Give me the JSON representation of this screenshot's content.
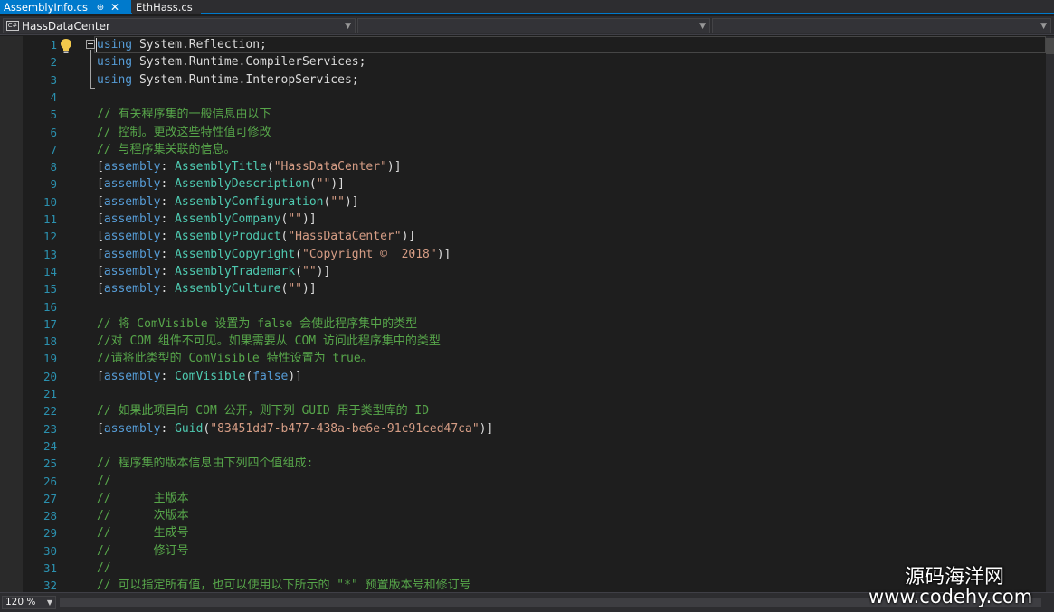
{
  "tabs": [
    {
      "label": "AssemblyInfo.cs",
      "pin_icon": "pin-icon",
      "close_icon": "close-icon"
    },
    {
      "label": "EthHass.cs"
    }
  ],
  "nav": {
    "project": "HassDataCenter",
    "project_icon": "csharp-project-icon",
    "icon_text": "C#"
  },
  "editor": {
    "lightbulb_icon": "lightbulb-icon",
    "collapse_icon": "collapse-minus-icon",
    "line_numbers": [
      "1",
      "2",
      "3",
      "4",
      "5",
      "6",
      "7",
      "8",
      "9",
      "10",
      "11",
      "12",
      "13",
      "14",
      "15",
      "16",
      "17",
      "18",
      "19",
      "20",
      "21",
      "22",
      "23",
      "24",
      "25",
      "26",
      "27",
      "28",
      "29",
      "30",
      "31",
      "32"
    ],
    "lines": [
      [
        [
          "kw",
          "using"
        ],
        [
          "p",
          " System.Reflection;"
        ]
      ],
      [
        [
          "kw",
          "using"
        ],
        [
          "p",
          " System.Runtime.CompilerServices;"
        ]
      ],
      [
        [
          "kw",
          "using"
        ],
        [
          "p",
          " System.Runtime.InteropServices;"
        ]
      ],
      [],
      [
        [
          "cm",
          "// 有关程序集的一般信息由以下"
        ]
      ],
      [
        [
          "cm",
          "// 控制。更改这些特性值可修改"
        ]
      ],
      [
        [
          "cm",
          "// 与程序集关联的信息。"
        ]
      ],
      [
        [
          "p",
          "["
        ],
        [
          "kw",
          "assembly"
        ],
        [
          "p",
          ": "
        ],
        [
          "ty",
          "AssemblyTitle"
        ],
        [
          "p",
          "("
        ],
        [
          "str",
          "\"HassDataCenter\""
        ],
        [
          "p",
          ")]"
        ]
      ],
      [
        [
          "p",
          "["
        ],
        [
          "kw",
          "assembly"
        ],
        [
          "p",
          ": "
        ],
        [
          "ty",
          "AssemblyDescription"
        ],
        [
          "p",
          "("
        ],
        [
          "str",
          "\"\""
        ],
        [
          "p",
          ")]"
        ]
      ],
      [
        [
          "p",
          "["
        ],
        [
          "kw",
          "assembly"
        ],
        [
          "p",
          ": "
        ],
        [
          "ty",
          "AssemblyConfiguration"
        ],
        [
          "p",
          "("
        ],
        [
          "str",
          "\"\""
        ],
        [
          "p",
          ")]"
        ]
      ],
      [
        [
          "p",
          "["
        ],
        [
          "kw",
          "assembly"
        ],
        [
          "p",
          ": "
        ],
        [
          "ty",
          "AssemblyCompany"
        ],
        [
          "p",
          "("
        ],
        [
          "str",
          "\"\""
        ],
        [
          "p",
          ")]"
        ]
      ],
      [
        [
          "p",
          "["
        ],
        [
          "kw",
          "assembly"
        ],
        [
          "p",
          ": "
        ],
        [
          "ty",
          "AssemblyProduct"
        ],
        [
          "p",
          "("
        ],
        [
          "str",
          "\"HassDataCenter\""
        ],
        [
          "p",
          ")]"
        ]
      ],
      [
        [
          "p",
          "["
        ],
        [
          "kw",
          "assembly"
        ],
        [
          "p",
          ": "
        ],
        [
          "ty",
          "AssemblyCopyright"
        ],
        [
          "p",
          "("
        ],
        [
          "str",
          "\"Copyright ©  2018\""
        ],
        [
          "p",
          ")]"
        ]
      ],
      [
        [
          "p",
          "["
        ],
        [
          "kw",
          "assembly"
        ],
        [
          "p",
          ": "
        ],
        [
          "ty",
          "AssemblyTrademark"
        ],
        [
          "p",
          "("
        ],
        [
          "str",
          "\"\""
        ],
        [
          "p",
          ")]"
        ]
      ],
      [
        [
          "p",
          "["
        ],
        [
          "kw",
          "assembly"
        ],
        [
          "p",
          ": "
        ],
        [
          "ty",
          "AssemblyCulture"
        ],
        [
          "p",
          "("
        ],
        [
          "str",
          "\"\""
        ],
        [
          "p",
          ")]"
        ]
      ],
      [],
      [
        [
          "cm",
          "// 将 ComVisible 设置为 false 会使此程序集中的类型"
        ]
      ],
      [
        [
          "cm",
          "//对 COM 组件不可见。如果需要从 COM 访问此程序集中的类型"
        ]
      ],
      [
        [
          "cm",
          "//请将此类型的 ComVisible 特性设置为 true。"
        ]
      ],
      [
        [
          "p",
          "["
        ],
        [
          "kw",
          "assembly"
        ],
        [
          "p",
          ": "
        ],
        [
          "ty",
          "ComVisible"
        ],
        [
          "p",
          "("
        ],
        [
          "kw",
          "false"
        ],
        [
          "p",
          ")]"
        ]
      ],
      [],
      [
        [
          "cm",
          "// 如果此项目向 COM 公开，则下列 GUID 用于类型库的 ID"
        ]
      ],
      [
        [
          "p",
          "["
        ],
        [
          "kw",
          "assembly"
        ],
        [
          "p",
          ": "
        ],
        [
          "ty",
          "Guid"
        ],
        [
          "p",
          "("
        ],
        [
          "str",
          "\"83451dd7-b477-438a-be6e-91c91ced47ca\""
        ],
        [
          "p",
          ")]"
        ]
      ],
      [],
      [
        [
          "cm",
          "// 程序集的版本信息由下列四个值组成:"
        ]
      ],
      [
        [
          "cm",
          "//"
        ]
      ],
      [
        [
          "cm",
          "//      主版本"
        ]
      ],
      [
        [
          "cm",
          "//      次版本"
        ]
      ],
      [
        [
          "cm",
          "//      生成号"
        ]
      ],
      [
        [
          "cm",
          "//      修订号"
        ]
      ],
      [
        [
          "cm",
          "//"
        ]
      ],
      [
        [
          "cm",
          "// 可以指定所有值，也可以使用以下所示的 \"*\" 预置版本号和修订号"
        ]
      ]
    ]
  },
  "zoom": {
    "value": "120 %"
  },
  "watermark": {
    "cn": "源码海洋网",
    "url": "www.codehy.com"
  },
  "colors": {
    "accent": "#007acc",
    "keyword": "#569cd6",
    "comment": "#57a64a",
    "string": "#d69d85",
    "type": "#4ec9b0",
    "line_number": "#2b91af",
    "lightbulb": "#f2c94c"
  }
}
